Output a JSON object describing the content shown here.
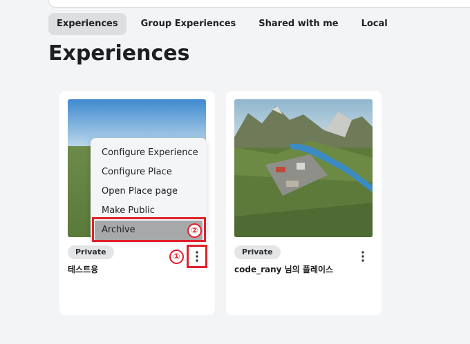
{
  "tabs": [
    {
      "label": "Experiences",
      "active": true
    },
    {
      "label": "Group Experiences",
      "active": false
    },
    {
      "label": "Shared with me",
      "active": false
    },
    {
      "label": "Local",
      "active": false
    }
  ],
  "page_title": "Experiences",
  "experiences": [
    {
      "badge": "Private",
      "name": "테스트용"
    },
    {
      "badge": "Private",
      "name": "code_rany 님의 플레이스"
    }
  ],
  "context_menu": {
    "items": [
      {
        "label": "Configure Experience"
      },
      {
        "label": "Configure Place"
      },
      {
        "label": "Open Place page"
      },
      {
        "label": "Make Public"
      },
      {
        "label": "Archive"
      }
    ]
  },
  "annotations": {
    "step1": "①",
    "step2": "②",
    "color": "#e0202a"
  },
  "icons": {
    "more": "more-vertical-icon"
  }
}
